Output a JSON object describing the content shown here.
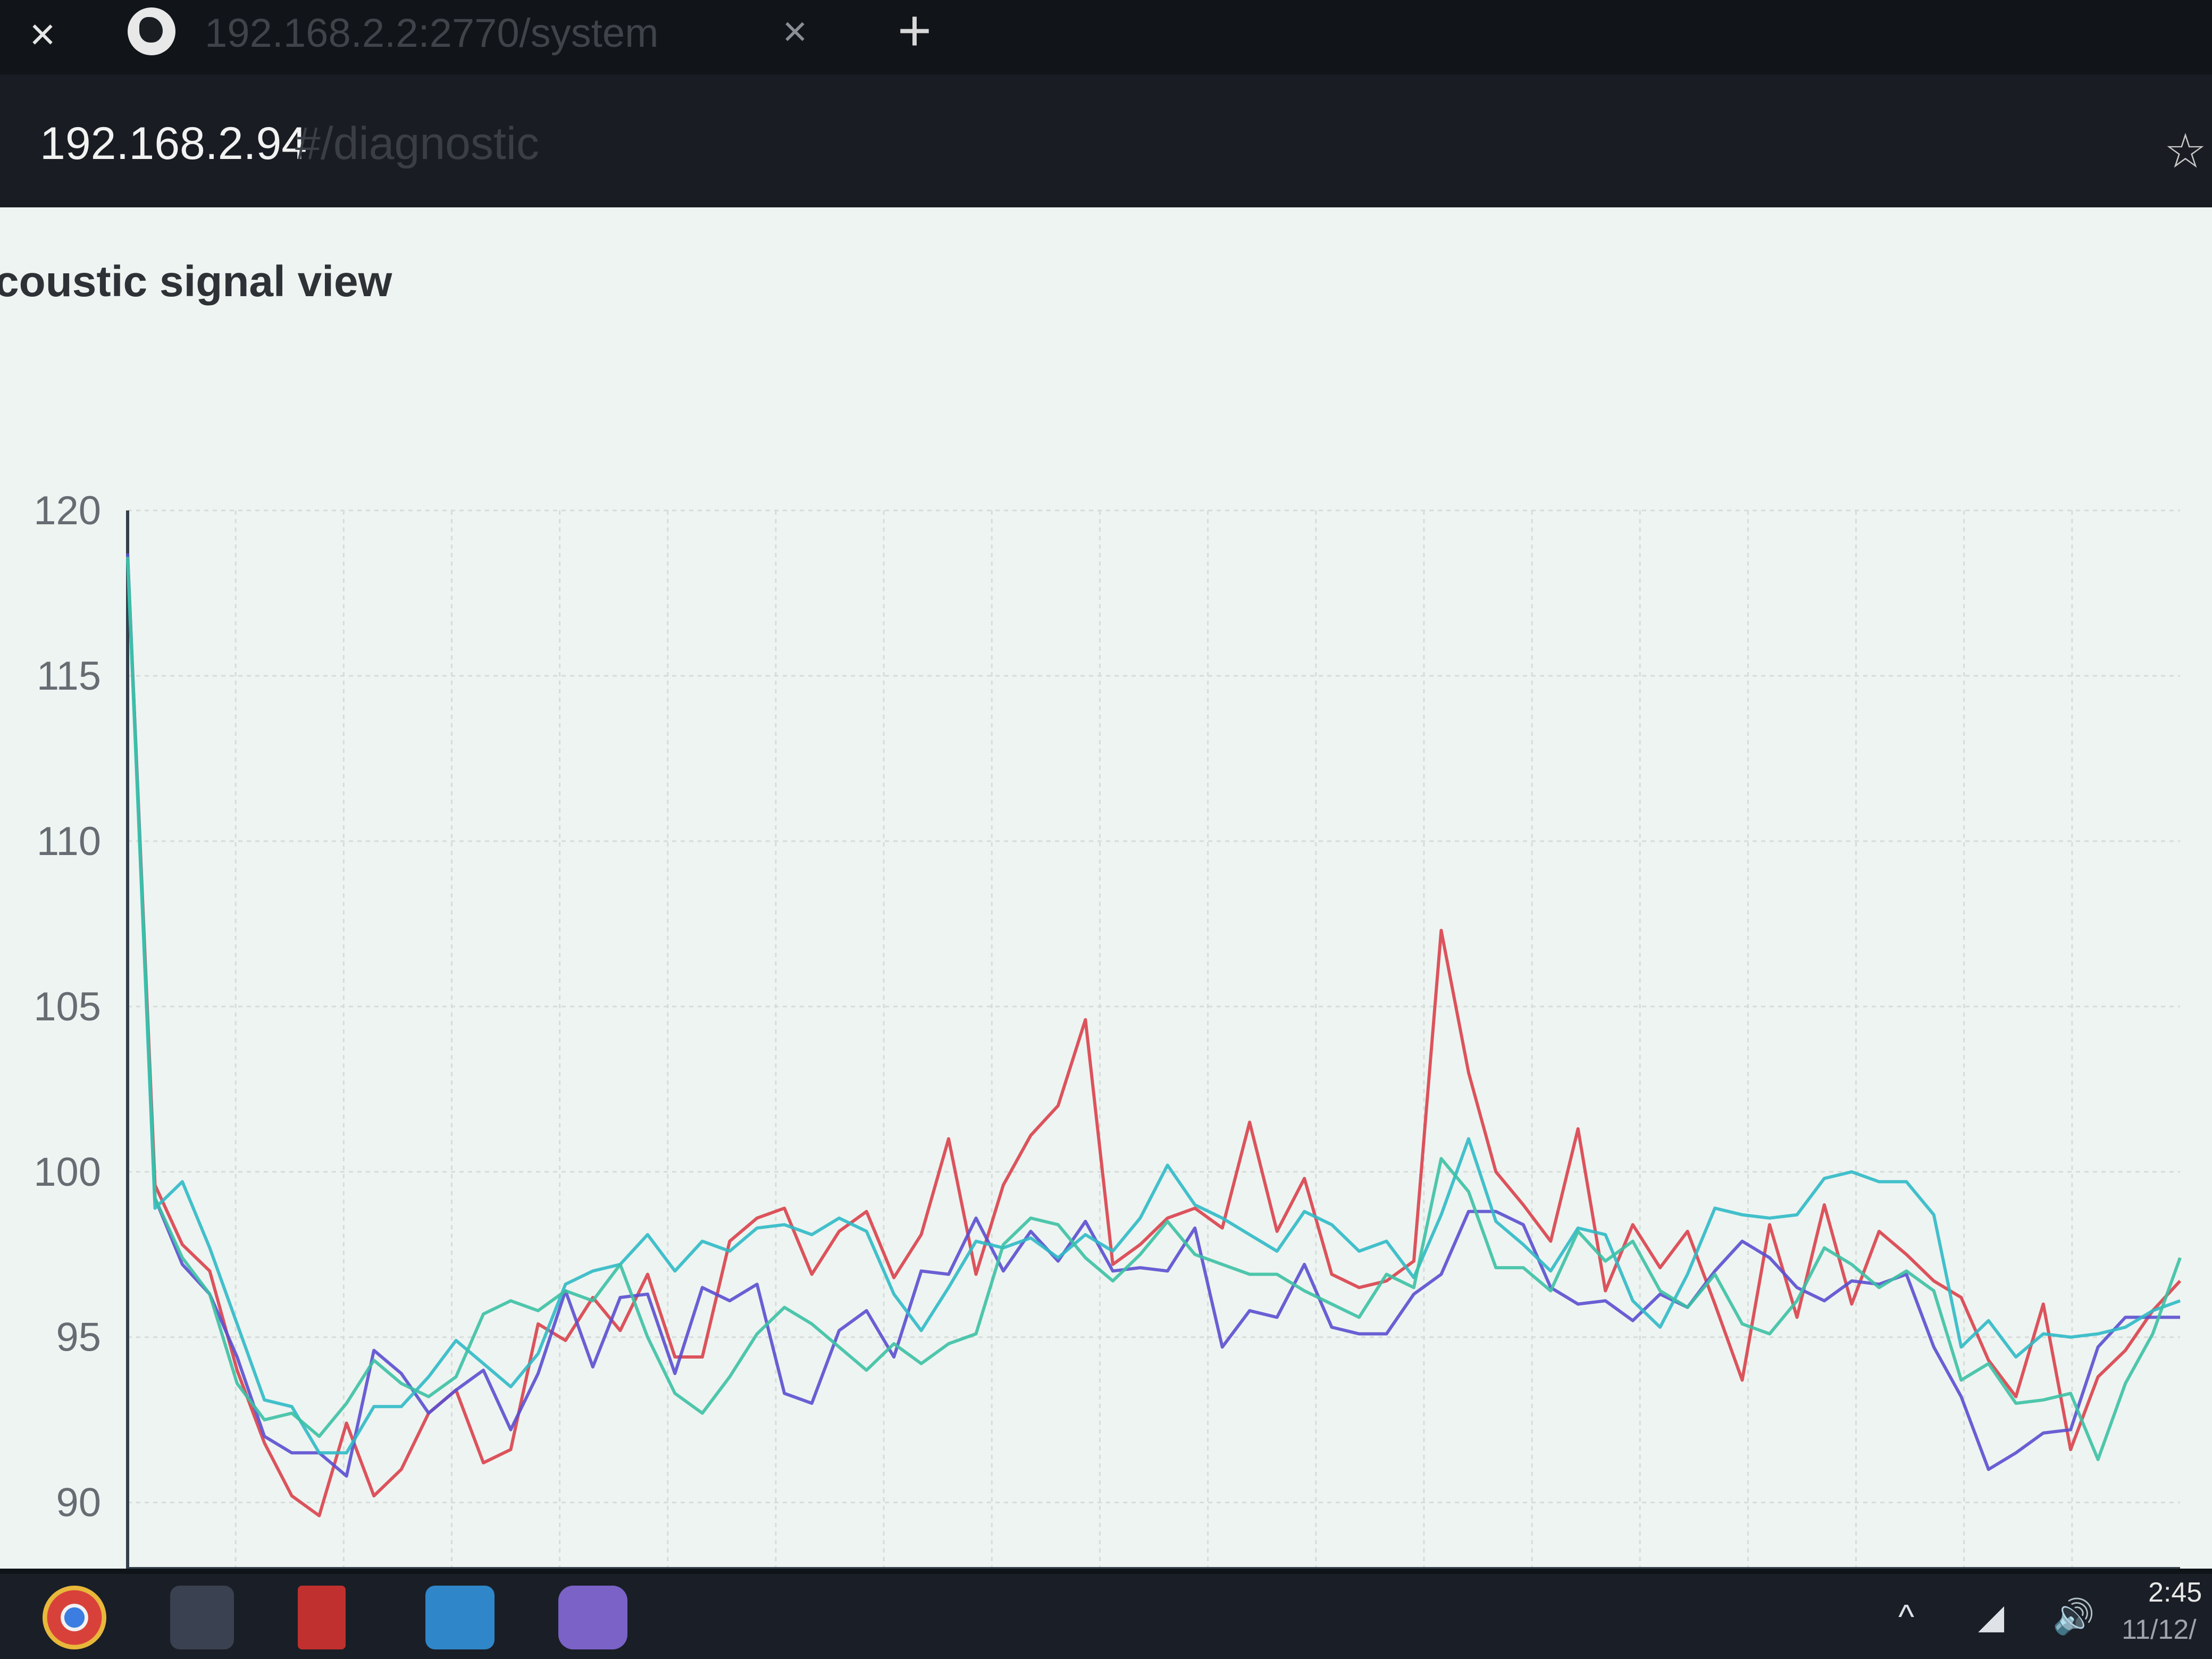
{
  "browser": {
    "tab": {
      "title": "192.168.2.2:2770/system",
      "icon": "globe-icon"
    },
    "new_tab_label": "+",
    "close_label": "×",
    "address": {
      "host": "192.168.2.94",
      "path": "#/diagnostic"
    },
    "bookmark_icon": "star-icon"
  },
  "page": {
    "title": "coustic signal view"
  },
  "chart_data": {
    "type": "line",
    "title": "",
    "xlabel": "",
    "ylabel": "",
    "ylim": [
      88,
      120
    ],
    "yticks": [
      120,
      115,
      110,
      105,
      100,
      95,
      90
    ],
    "grid": true,
    "legend": "none",
    "series": [
      {
        "color": "#d9414b",
        "values": [
          118.6,
          99.6,
          97.8,
          97.0,
          94.0,
          91.8,
          90.2,
          89.6,
          92.4,
          90.2,
          91.0,
          92.7,
          93.4,
          91.2,
          91.6,
          95.4,
          94.9,
          96.2,
          95.2,
          96.9,
          94.4,
          94.4,
          97.9,
          98.6,
          98.9,
          96.9,
          98.2,
          98.8,
          96.8,
          98.1,
          101.0,
          96.9,
          99.6,
          101.1,
          102.0,
          104.6,
          97.2,
          97.8,
          98.6,
          98.9,
          98.3,
          101.5,
          98.2,
          99.8,
          96.9,
          96.5,
          96.7,
          97.3,
          107.3,
          103.0,
          100.0,
          99.0,
          97.9,
          101.3,
          96.4,
          98.4,
          97.1,
          98.2,
          96.0,
          93.7,
          98.4,
          95.6,
          99.0,
          96.0,
          98.2,
          97.5,
          96.7,
          96.2,
          94.3,
          93.2,
          96.0,
          91.6,
          93.8,
          94.6,
          95.8,
          96.7
        ]
      },
      {
        "color": "#5a4fd0",
        "values": [
          118.7,
          99.2,
          97.2,
          96.3,
          94.4,
          92.0,
          91.5,
          91.5,
          90.8,
          94.6,
          93.9,
          92.7,
          93.4,
          94.0,
          92.2,
          93.9,
          96.4,
          94.1,
          96.2,
          96.3,
          93.9,
          96.5,
          96.1,
          96.6,
          93.3,
          93.0,
          95.2,
          95.8,
          94.4,
          97.0,
          96.9,
          98.6,
          97.0,
          98.2,
          97.3,
          98.5,
          97.0,
          97.1,
          97.0,
          98.3,
          94.7,
          95.8,
          95.6,
          97.2,
          95.3,
          95.1,
          95.1,
          96.3,
          96.9,
          98.8,
          98.8,
          98.4,
          96.5,
          96.0,
          96.1,
          95.5,
          96.3,
          95.9,
          97.0,
          97.9,
          97.4,
          96.5,
          96.1,
          96.7,
          96.6,
          96.9,
          94.7,
          93.2,
          91.0,
          91.5,
          92.1,
          92.2,
          94.7,
          95.6,
          95.6,
          95.6
        ]
      },
      {
        "color": "#2fbac7",
        "values": [
          118.5,
          98.9,
          99.7,
          97.7,
          95.4,
          93.1,
          92.9,
          91.5,
          91.5,
          92.9,
          92.9,
          93.8,
          94.9,
          94.2,
          93.5,
          94.5,
          96.6,
          97.0,
          97.2,
          98.1,
          97.0,
          97.9,
          97.6,
          98.3,
          98.4,
          98.1,
          98.6,
          98.2,
          96.3,
          95.2,
          96.5,
          97.9,
          97.7,
          98.0,
          97.4,
          98.1,
          97.6,
          98.6,
          100.2,
          99.0,
          98.6,
          98.1,
          97.6,
          98.8,
          98.4,
          97.6,
          97.9,
          96.8,
          98.7,
          101.0,
          98.5,
          97.8,
          97.0,
          98.3,
          98.1,
          96.1,
          95.3,
          96.9,
          98.9,
          98.7,
          98.6,
          98.7,
          99.8,
          100.0,
          99.7,
          99.7,
          98.7,
          94.7,
          95.5,
          94.4,
          95.1,
          95.0,
          95.1,
          95.3,
          95.8,
          96.1
        ]
      },
      {
        "color": "#3cc1a4",
        "values": [
          118.6,
          99.2,
          97.4,
          96.3,
          93.6,
          92.5,
          92.7,
          92.0,
          93.0,
          94.3,
          93.6,
          93.2,
          93.8,
          95.7,
          96.1,
          95.8,
          96.4,
          96.1,
          97.2,
          95.0,
          93.3,
          92.7,
          93.8,
          95.1,
          95.9,
          95.4,
          94.7,
          94.0,
          94.8,
          94.2,
          94.8,
          95.1,
          97.8,
          98.6,
          98.4,
          97.4,
          96.7,
          97.5,
          98.5,
          97.5,
          97.2,
          96.9,
          96.9,
          96.4,
          96.0,
          95.6,
          96.9,
          96.5,
          100.4,
          99.4,
          97.1,
          97.1,
          96.4,
          98.2,
          97.3,
          97.9,
          96.4,
          95.9,
          96.9,
          95.4,
          95.1,
          96.1,
          97.7,
          97.2,
          96.5,
          97.0,
          96.4,
          93.7,
          94.2,
          93.0,
          93.1,
          93.3,
          91.3,
          93.6,
          95.1,
          97.4
        ]
      }
    ]
  },
  "taskbar": {
    "apps": [
      "chrome-icon",
      "app-icon",
      "app-icon",
      "app-icon",
      "app-icon"
    ],
    "tray": {
      "up_arrow": "^",
      "wifi_icon": "wifi-icon",
      "volume_icon": "volume-icon"
    },
    "clock": {
      "time": "2:45",
      "date": "11/12/"
    }
  }
}
